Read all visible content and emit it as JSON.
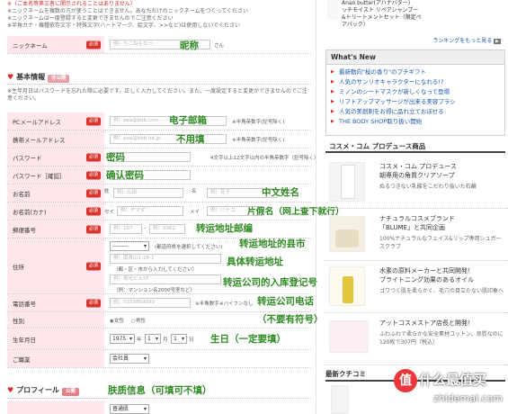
{
  "top_notes": [
    "※（ご本名等第三者に開示されることはありません）",
    "※ニックネームを複数の方が使うことはできません。あなただけのニックネームをつくってください",
    "※ニックネームは一度登録すると変更できませんのでご注意ください",
    "※半角カナ・機種依存文字・特殊文字(ハートマーク、絵文字、>>など)は使用しないでください"
  ],
  "nickname": {
    "label": "ニックネーム",
    "required": "必須",
    "placeholder": "例）ちこねもなっ",
    "suffix": "さん",
    "annotation": "昵称"
  },
  "basic": {
    "title": "基本情報",
    "badge": "非公開",
    "note": "※生年月日はパスワードを忘れた際に必要です。正しく入力してください。また、一度設定すると変更ができませんのでご注意ください。"
  },
  "fields": {
    "pc_mail": {
      "label": "PCメールアドレス",
      "required": "必須",
      "placeholder": "例）aaa@bbb.com",
      "hint": "※半角英数字(記号除く)",
      "annotation": "电子邮箱"
    },
    "mobile_mail": {
      "label": "携帯メールアドレス",
      "placeholder": "例）aaa@bbb.ne.jp",
      "hint": "※半角英数字(記号除く)",
      "annotation": "不用填"
    },
    "password": {
      "label": "パスワード",
      "required": "必須",
      "hint": "4文字以上12文字以内の半角英数字（記号除く）",
      "annotation": "密码"
    },
    "password_confirm": {
      "label": "パスワード［確認］",
      "required": "必須",
      "annotation": "确认密码"
    },
    "name": {
      "label": "お名前",
      "required": "必須",
      "sei": "姓",
      "mei": "名",
      "sei_ph": "例）山田",
      "mei_ph": "例）花子",
      "annotation": "中文姓名"
    },
    "kana": {
      "label": "お名前(カナ)",
      "required": "必須",
      "sei": "セイ",
      "mei": "メイ",
      "sei_ph": "例）ヤマダ",
      "mei_ph": "例）ハナコ",
      "annotation": "片假名（网上查下就行）"
    },
    "postal": {
      "label": "郵便番号",
      "required": "必須",
      "ph1": "例）107",
      "ph2": "例）0062",
      "annotation": "转运地址邮编"
    },
    "address": {
      "label": "住所",
      "required": "必須",
      "pref": "--------",
      "pref_hint": "(都道府県を選択してください)",
      "city_ph": "例）南青山1-26-1",
      "city_hint": "（都・区・市から入力してください）",
      "bldg_ph": "例）寿光ビル5F",
      "bldg_hint": "（例：マンション名2000号室など）",
      "annotation_city": "转运地址的县市",
      "annotation_street": "具体转运地址",
      "annotation_building": "转运公司的入库登记号"
    },
    "phone": {
      "label": "電話番号",
      "required": "必須",
      "placeholder": "例）0335859899",
      "hint": "※半角数字",
      "hint2": "※ハイフンなし",
      "annotation": "转运公司电话",
      "annotation2": "（不要有符号）"
    },
    "gender": {
      "label": "性別",
      "female": "女性",
      "male": "男性"
    },
    "birth": {
      "label": "生年月日",
      "year": "1975",
      "month": "1",
      "day": "1",
      "y": "年",
      "m": "月",
      "d": "日",
      "annotation": "生日（一定要填）"
    },
    "job": {
      "label": "ご職業",
      "value": "会社員"
    }
  },
  "profile": {
    "title": "プロフィール",
    "badge": "公開",
    "annotation": "肤质信息（可填可不填）",
    "select": "普通肌"
  },
  "sidebar": {
    "top_product_lines": [
      "Anao butter(アハナバター)",
      "ッチモイスト リペアシャンプー",
      "&トリートメントセット（限定ペ",
      "アパック）"
    ],
    "ranking_link": "ランキングをもっと見る",
    "whats_new_title": "What's New",
    "news": [
      "最新動向\"桜の香り\"のプチギフト",
      "人気のサンリオキャラクターになれる!?",
      "ミノンのシートマスクが新しくなって登場",
      "リフトアップマッサージが出来る美容プラシ",
      "人気の美創刺をお得に品れ立ておぼせる",
      "THE BODY SHOP取り扱い開始"
    ],
    "produce_title": "コスメ・コム プロデュース商品",
    "products": [
      {
        "title": "コスメ・コム プロデュース",
        "title2": "朝専用の角質クリアソープ",
        "desc": "ぬるつきない乳酸をこだわり抜いた石鹸"
      },
      {
        "title": "ナチュラルコスメブランド",
        "title2": "「BLUME」と共同企画",
        "desc": "100%ナチュラルなフェイス&リップ専用シュガースクラブ"
      },
      {
        "title": "水素の原料メーカーと共同開発！",
        "title2": "ブライトニング効果のあるオイル",
        "desc": "ゴワつく肌を柔らかく、毛穴の目立たない肌印象へ"
      },
      {
        "title": "アットコスメストア店長と開発！",
        "title2": "",
        "desc": "ふわふわで柔らかな安全素材コットン。良質なのに120枚で307円（税込）"
      }
    ],
    "kuchikomi_title": "最新クチコミ"
  },
  "watermark": {
    "badge": "值",
    "text": "什么最值买",
    "url": "zhidemai.com"
  }
}
